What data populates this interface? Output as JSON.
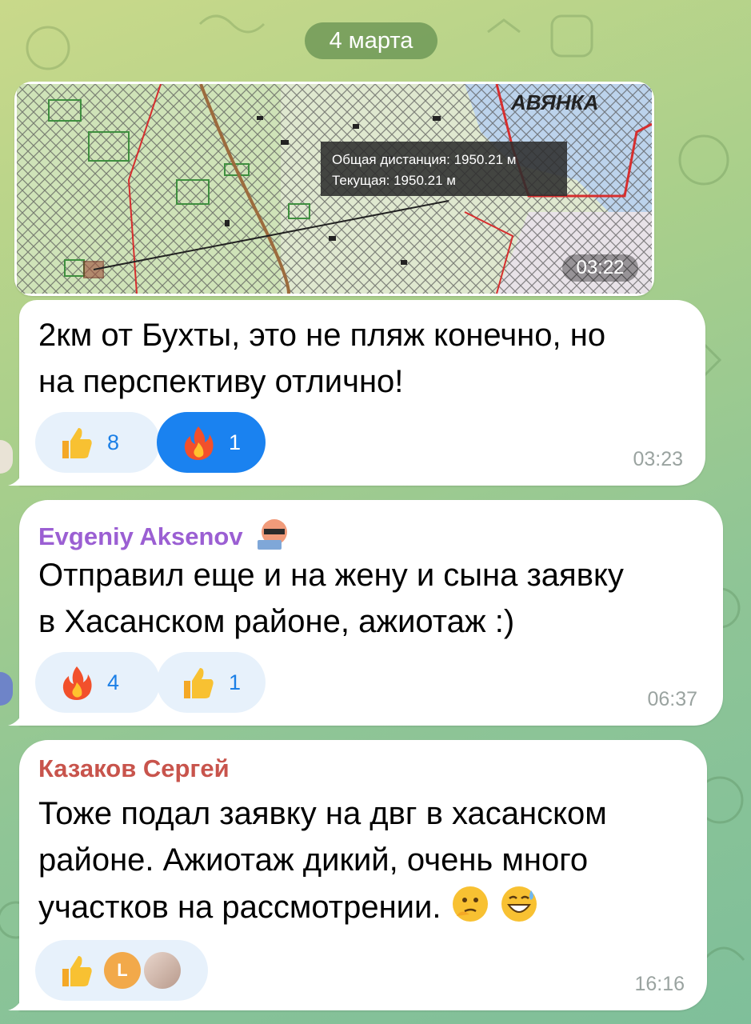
{
  "date_separator": "4 марта",
  "map_message": {
    "label_distance_total": "Общая дистанция: 1950.21 м",
    "label_distance_current": "Текущая: 1950.21 м",
    "place_label": "АВЯНКА",
    "time": "03:22"
  },
  "messages": [
    {
      "text_line1": "2км от Бухты, это не пляж конечно, но",
      "text_line2": "на перспективу отлично!",
      "time": "03:23",
      "reactions": [
        {
          "emoji": "thumbs-up",
          "count": "8",
          "active": false
        },
        {
          "emoji": "fire",
          "count": "1",
          "active": true
        }
      ]
    },
    {
      "sender": "Evgeniy Aksenov",
      "sender_color": "#9b5fd3",
      "text_line1": "Отправил еще и на жену и сына заявку",
      "text_line2": "в Хасанском районе, ажиотаж :)",
      "time": "06:37",
      "reactions": [
        {
          "emoji": "fire",
          "count": "4",
          "active": false
        },
        {
          "emoji": "thumbs-up",
          "count": "1",
          "active": false
        }
      ]
    },
    {
      "sender": "Казаков Сергей",
      "sender_color": "#c8544c",
      "text_line1": "Тоже подал заявку на двг в хасанском",
      "text_line2": "районе. Ажиотаж дикий, очень много",
      "text_line3": "участков на рассмотрении.",
      "time": "16:16",
      "reactions": [
        {
          "emoji": "thumbs-up",
          "count": "",
          "active": false,
          "avatars": [
            "L",
            "photo"
          ]
        }
      ]
    }
  ]
}
